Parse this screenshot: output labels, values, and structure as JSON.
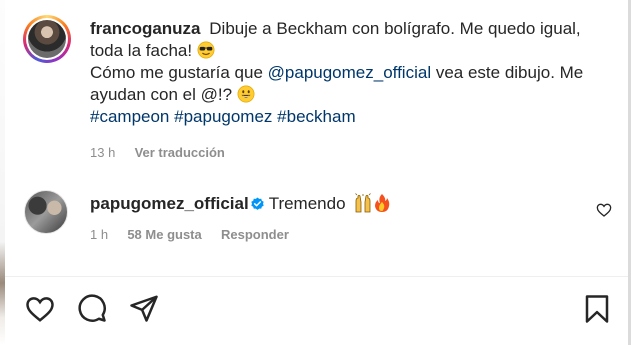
{
  "post": {
    "author": "francoganuza",
    "caption_line1": "Dibuje a Beckham con bolígrafo. Me quedo igual, toda la facha!",
    "caption_line2_pre": "Cómo me gustaría que",
    "caption_mention": "@papugomez_official",
    "caption_line2_post": "vea este dibujo. Me ayudan con el @!?",
    "hashtags": [
      "#campeon",
      "#papugomez",
      "#beckham"
    ],
    "time": "13 h",
    "translate_label": "Ver traducción"
  },
  "reply": {
    "author": "papugomez_official",
    "text": "Tremendo",
    "time": "1 h",
    "likes": "58 Me gusta",
    "reply_label": "Responder"
  },
  "icons": {
    "caption_emoji_1": "sunglasses-emoji-icon",
    "caption_emoji_2": "grinning-emoji-icon",
    "reply_emoji_1": "raised-hands-emoji-icon",
    "reply_emoji_2": "fire-emoji-icon",
    "verified": "verified-badge-icon",
    "like": "heart-icon",
    "comment": "comment-bubble-icon",
    "share": "paper-plane-icon",
    "save": "bookmark-icon"
  },
  "colors": {
    "text": "#262626",
    "link": "#00376b",
    "meta": "#8e8e8e",
    "verified": "#0095f6"
  }
}
